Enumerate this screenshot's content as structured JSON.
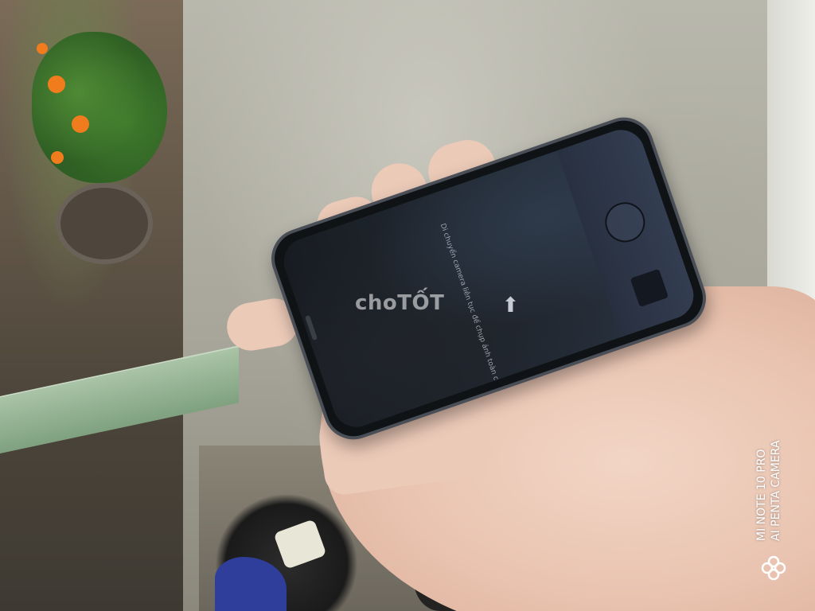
{
  "photo": {
    "watermark": "choTỐT",
    "phone_screen": {
      "arrow_glyph": "⬆",
      "hint_text": "Di chuyển camera liên tục để chụp ảnh toàn cảnh"
    },
    "camera_stamp": {
      "line1": "MI NOTE 10 PRO",
      "line2": "AI PENTA CAMERA"
    },
    "colors": {
      "phone_frame": "#4a4e56",
      "skin": "#eccab8",
      "plank": "#a9c4a6",
      "flowers": "#f07c1e"
    }
  }
}
